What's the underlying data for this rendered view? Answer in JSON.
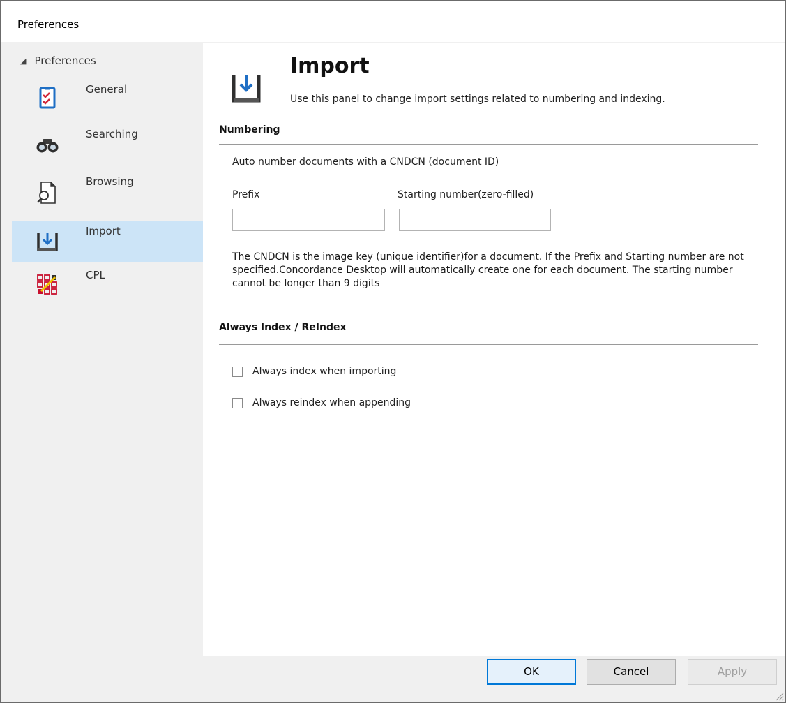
{
  "window": {
    "title": "Preferences"
  },
  "sidebar": {
    "root_label": "Preferences",
    "items": [
      {
        "label": "General",
        "icon": "checklist-icon",
        "selected": false
      },
      {
        "label": "Searching",
        "icon": "binoculars-icon",
        "selected": false
      },
      {
        "label": "Browsing",
        "icon": "document-magnifier-icon",
        "selected": false
      },
      {
        "label": "Import",
        "icon": "import-icon",
        "selected": true
      },
      {
        "label": "CPL",
        "icon": "grid-pencil-icon",
        "selected": false
      }
    ]
  },
  "header": {
    "title": "Import",
    "description": "Use this panel to change import settings related to numbering and indexing."
  },
  "numbering": {
    "heading": "Numbering",
    "auto_label": "Auto number documents with a CNDCN (document ID)",
    "prefix_label": "Prefix",
    "prefix_value": "",
    "start_label": "Starting number(zero-filled)",
    "start_value": "",
    "info": "The CNDCN is the image key (unique identifier)for a document. If the Prefix and Starting number are not specified.Concordance Desktop will automatically create one for each document. The starting number cannot be longer than 9 digits"
  },
  "indexing": {
    "heading": "Always Index / ReIndex",
    "options": [
      {
        "label": "Always index when importing",
        "checked": false
      },
      {
        "label": "Always reindex when appending",
        "checked": false
      }
    ]
  },
  "footer": {
    "ok": {
      "accel": "O",
      "rest": "K"
    },
    "cancel": {
      "accel": "C",
      "rest": "ancel"
    },
    "apply": {
      "accel": "A",
      "rest": "pply",
      "disabled": true
    }
  },
  "colors": {
    "selection": "#cce4f7",
    "accent": "#0078d7",
    "sidebar_bg": "#f0f0f0"
  }
}
